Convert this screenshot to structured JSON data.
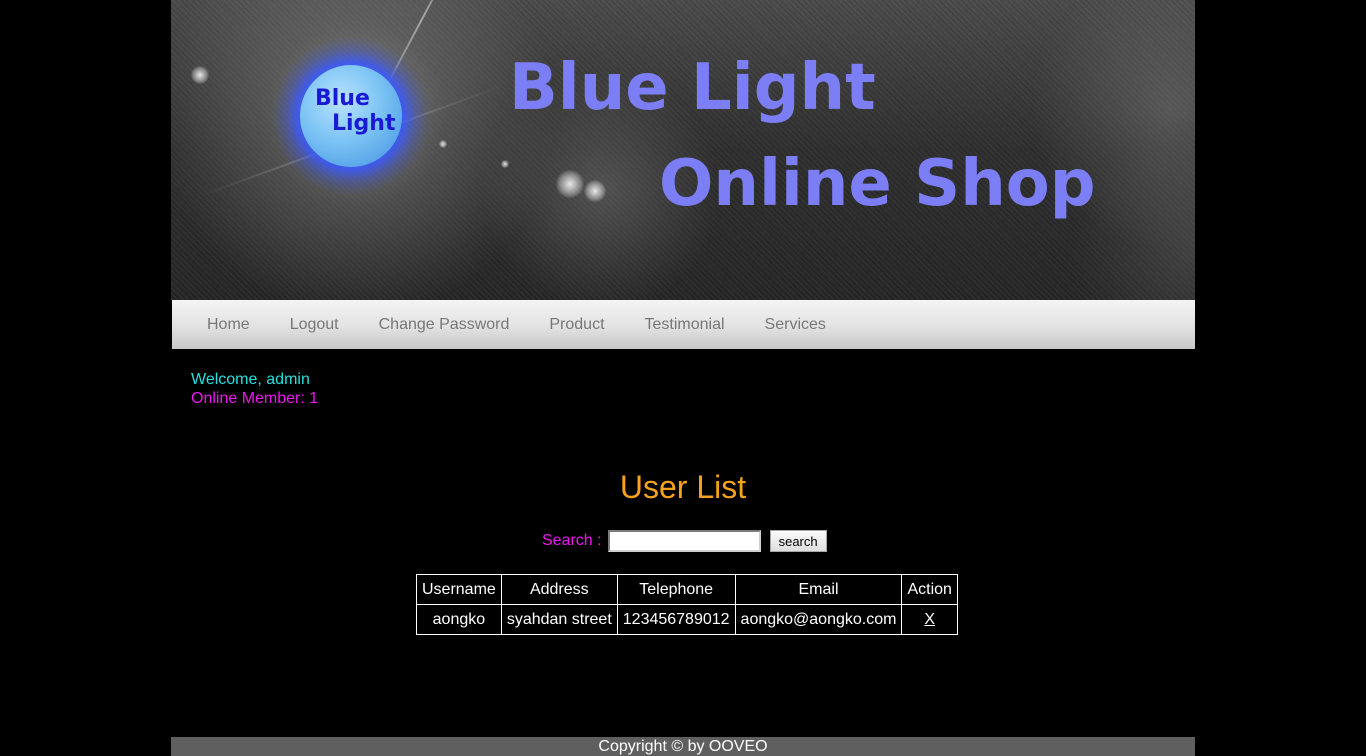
{
  "banner": {
    "logo_line1": "Blue",
    "logo_line2": "Light",
    "title_line1": "Blue Light",
    "title_line2": "Online Shop"
  },
  "nav": {
    "items": [
      {
        "label": "Home"
      },
      {
        "label": "Logout"
      },
      {
        "label": "Change Password"
      },
      {
        "label": "Product"
      },
      {
        "label": "Testimonial"
      },
      {
        "label": "Services"
      }
    ]
  },
  "user": {
    "welcome": "Welcome, admin",
    "online_members": "Online Member: 1"
  },
  "main": {
    "title": "User List",
    "search_label": "Search :",
    "search_value": "",
    "search_button": "search"
  },
  "table": {
    "headers": [
      "Username",
      "Address",
      "Telephone",
      "Email",
      "Action"
    ],
    "rows": [
      {
        "username": "aongko",
        "address": "syahdan street",
        "telephone": "123456789012",
        "email": "aongko@aongko.com",
        "action": "X"
      }
    ]
  },
  "footer": {
    "text": "Copyright © by OOVEO"
  },
  "colors": {
    "page_bg": "#000000",
    "title_blue": "#7b7ef4",
    "welcome_cyan": "#26e0e0",
    "magenta": "#ee16ee",
    "heading_orange": "#f7a21c",
    "footer_bg": "#5f5f5f"
  }
}
